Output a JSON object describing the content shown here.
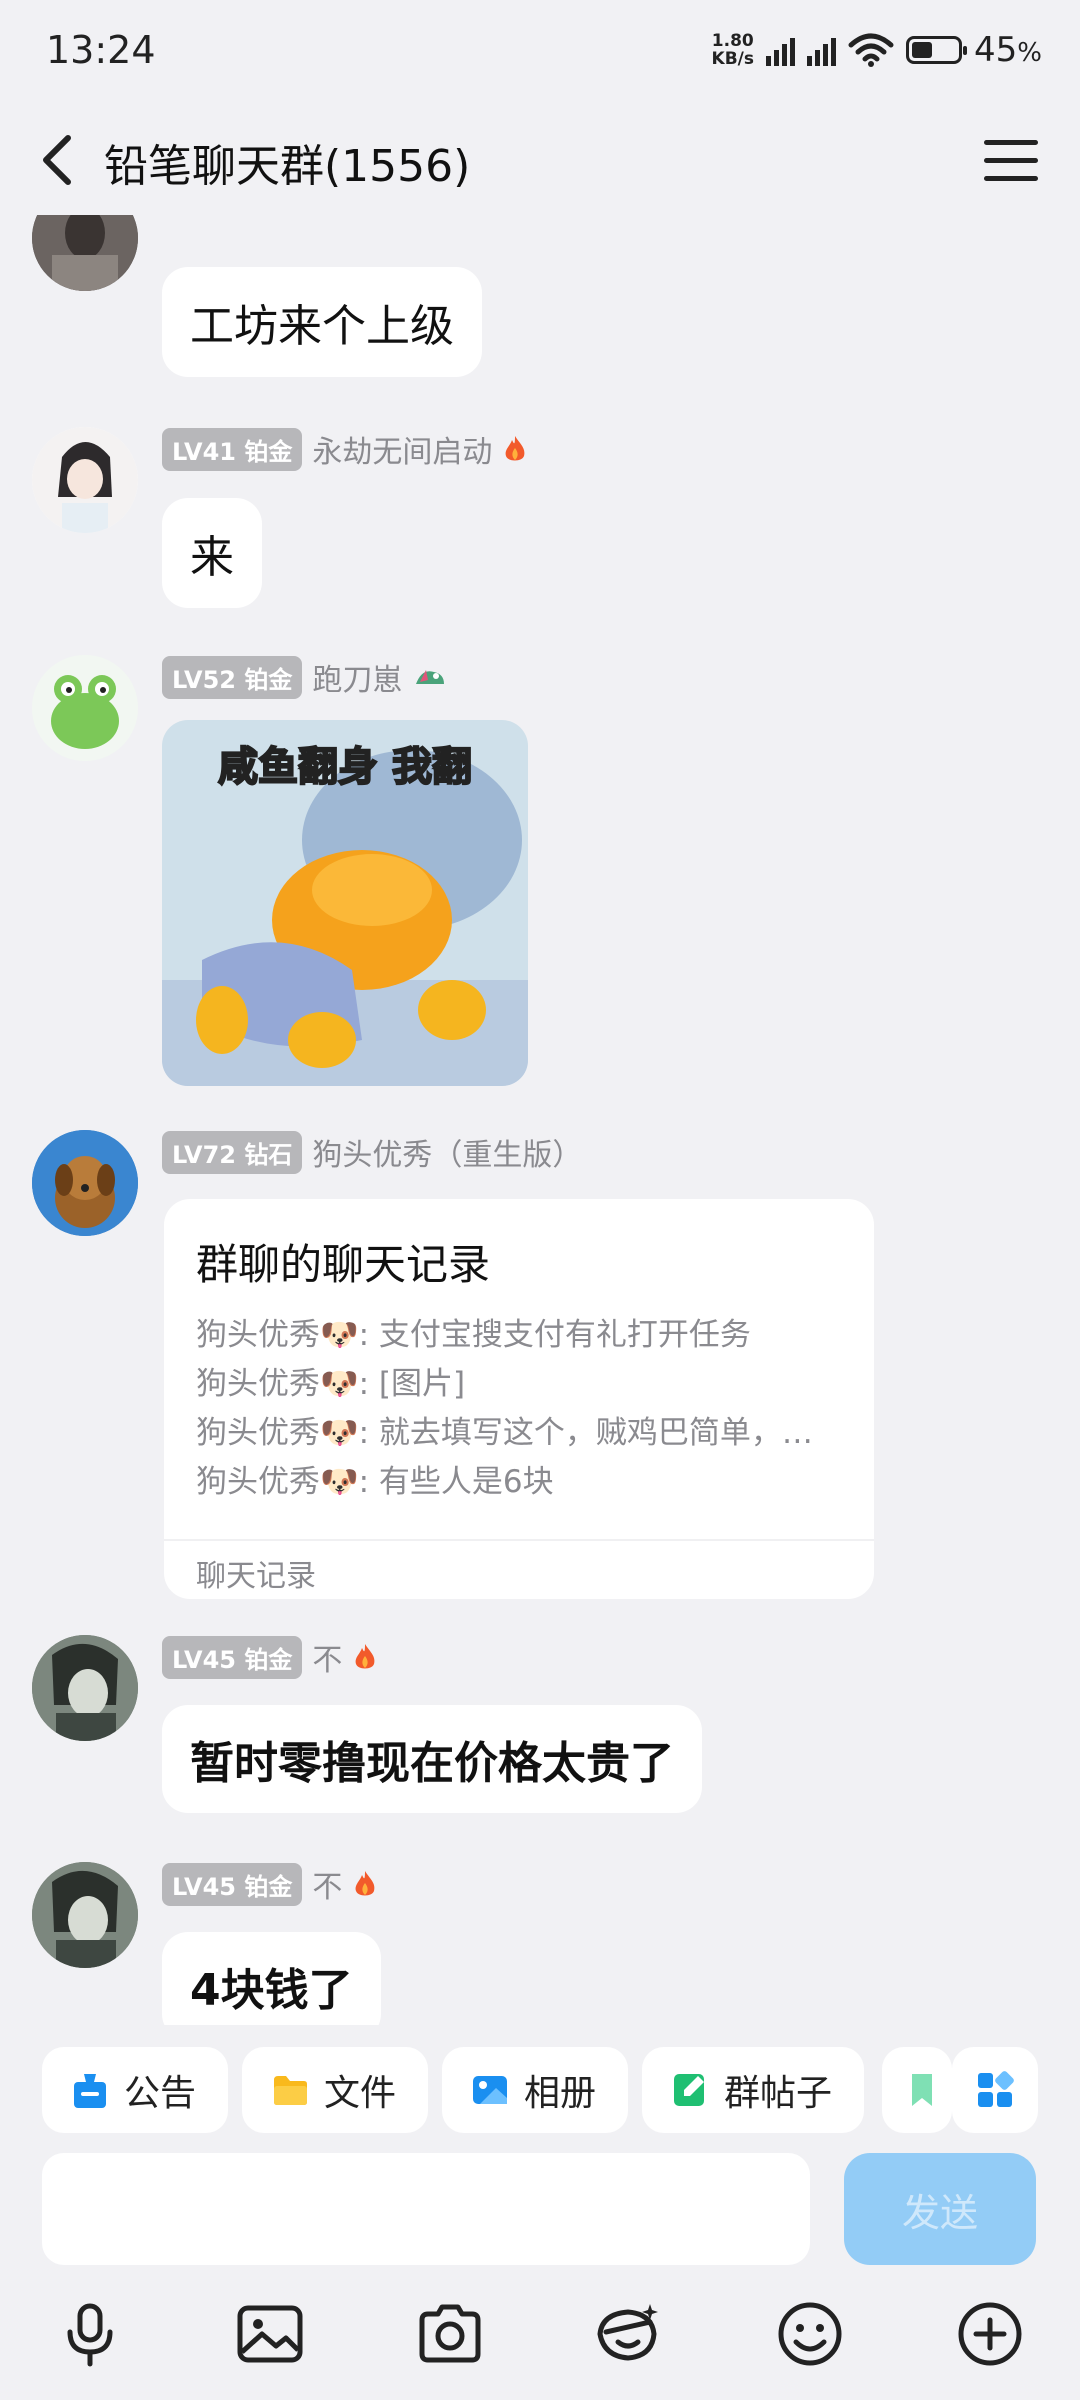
{
  "status": {
    "time": "13:24",
    "net_speed_value": "1.80",
    "net_speed_unit": "KB/s",
    "battery_pct": "45",
    "battery_unit": "%",
    "battery_level": 0.45
  },
  "header": {
    "title": "铅笔聊天群(1556)"
  },
  "messages": [
    {
      "bubble": "工坊来个上级"
    },
    {
      "badge": "LV41 铂金",
      "nick": "永劫无间启动",
      "bubble": "来"
    },
    {
      "badge": "LV52 铂金",
      "nick": "跑刀崽",
      "sticker_caption": "咸鱼翻身 我翻"
    },
    {
      "badge": "LV72 钻石",
      "nick": "狗头优秀（重生版）"
    },
    {
      "badge": "LV45 铂金",
      "nick": "不",
      "bubble": "暂时零撸现在价格太贵了"
    },
    {
      "badge": "LV45 铂金",
      "nick": "不",
      "bubble": "4块钱了"
    }
  ],
  "forward_card": {
    "title": "群聊的聊天记录",
    "lines": [
      "狗头优秀🐶: 支付宝搜支付有礼打开任务",
      "狗头优秀🐶: [图片]",
      "狗头优秀🐶: 就去填写这个，贼鸡巴简单，…",
      "狗头优秀🐶: 有些人是6块"
    ],
    "footer": "聊天记录"
  },
  "shortcuts": [
    "公告",
    "文件",
    "相册",
    "群帖子"
  ],
  "input": {
    "placeholder": "",
    "send_label": "发送"
  },
  "colors": {
    "accent": "#1a8ff0",
    "send_disabled": "#93ccf6",
    "badge": "#b7b7ba",
    "background": "#f1f1f4"
  },
  "icons": {
    "toolbar": [
      "microphone-icon",
      "image-icon",
      "camera-icon",
      "sticker-icon",
      "emoji-icon",
      "plus-icon"
    ],
    "shortcuts": [
      "announcement-icon",
      "folder-icon",
      "album-icon",
      "post-icon",
      "apps-icon"
    ]
  }
}
